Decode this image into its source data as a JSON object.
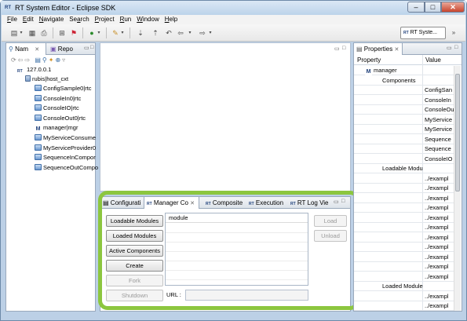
{
  "window": {
    "title": "RT System Editor - Eclipse SDK",
    "title_icon": "RT"
  },
  "menu": [
    "File",
    "Edit",
    "Navigate",
    "Search",
    "Project",
    "Run",
    "Window",
    "Help"
  ],
  "menu_mnemonics": [
    "F",
    "E",
    "N",
    "a",
    "P",
    "R",
    "W",
    "H"
  ],
  "toolbar": {
    "perspective_label": "RT Syste...",
    "perspective_icon": "RT"
  },
  "left_panel": {
    "tabs": [
      "Nam",
      "Repo"
    ],
    "tree": {
      "host": "127.0.0.1",
      "context": "rubis|host_cxt",
      "items": [
        {
          "label": "ConfigSample0|rtc",
          "icon": "rtc-icon"
        },
        {
          "label": "ConsoleIn0|rtc",
          "icon": "rtc-icon"
        },
        {
          "label": "ConsoleIO|rtc",
          "icon": "rtc-icon"
        },
        {
          "label": "ConsoleOut0|rtc",
          "icon": "rtc-icon"
        },
        {
          "label": "manager|mgr",
          "icon": "manager-icon"
        },
        {
          "label": "MyServiceConsume",
          "icon": "rtc-icon"
        },
        {
          "label": "MyServiceProvider0",
          "icon": "rtc-icon"
        },
        {
          "label": "SequenceInCompor",
          "icon": "rtc-icon"
        },
        {
          "label": "SequenceOutCompo",
          "icon": "rtc-icon"
        }
      ]
    }
  },
  "bottom_view": {
    "tabs": [
      "Configurati",
      "Manager Co",
      "Composite",
      "Execution",
      "RT Log Vie"
    ],
    "buttons": [
      {
        "label": "Loadable Modules",
        "enabled": true
      },
      {
        "label": "Loaded Modules",
        "enabled": true
      },
      {
        "label": "Active Components",
        "enabled": true
      },
      {
        "label": "Create",
        "enabled": true
      },
      {
        "label": "Fork",
        "enabled": false
      },
      {
        "label": "Shutdown",
        "enabled": false
      }
    ],
    "list_header": "module",
    "right_buttons": [
      "Load",
      "Unload"
    ],
    "url_label": "URL :",
    "url_value": ""
  },
  "properties": {
    "tab": "Properties",
    "col_property": "Property",
    "col_value": "Value",
    "rows": [
      {
        "property": "manager",
        "value": "",
        "indent": 1,
        "icon": "manager-icon"
      },
      {
        "property": "Components",
        "value": "",
        "indent": 2
      },
      {
        "property": "",
        "value": "ConfigSan",
        "indent": 2
      },
      {
        "property": "",
        "value": "ConsoleIn",
        "indent": 2
      },
      {
        "property": "",
        "value": "ConsoleOu",
        "indent": 2
      },
      {
        "property": "",
        "value": "MyService",
        "indent": 2
      },
      {
        "property": "",
        "value": "MyService",
        "indent": 2
      },
      {
        "property": "",
        "value": "Sequence",
        "indent": 2
      },
      {
        "property": "",
        "value": "Sequence",
        "indent": 2
      },
      {
        "property": "",
        "value": "ConsoleIO",
        "indent": 2
      },
      {
        "property": "Loadable Modu",
        "value": "",
        "indent": 2
      },
      {
        "property": "",
        "value": "../exampl",
        "indent": 2
      },
      {
        "property": "",
        "value": "../exampl",
        "indent": 2
      },
      {
        "property": "",
        "value": "../exampl",
        "indent": 2
      },
      {
        "property": "",
        "value": "../exampl",
        "indent": 2
      },
      {
        "property": "",
        "value": "../exampl",
        "indent": 2
      },
      {
        "property": "",
        "value": "../exampl",
        "indent": 2
      },
      {
        "property": "",
        "value": "../exampl",
        "indent": 2
      },
      {
        "property": "",
        "value": "../exampl",
        "indent": 2
      },
      {
        "property": "",
        "value": "../exampl",
        "indent": 2
      },
      {
        "property": "",
        "value": "../exampl",
        "indent": 2
      },
      {
        "property": "",
        "value": "../exampl",
        "indent": 2
      },
      {
        "property": "Loaded Module",
        "value": "",
        "indent": 2
      },
      {
        "property": "",
        "value": "../exampl",
        "indent": 2
      },
      {
        "property": "",
        "value": "../exampl",
        "indent": 2
      }
    ]
  },
  "colors": {
    "highlight": "#8cc63f",
    "frame": "#bcd0e6"
  }
}
